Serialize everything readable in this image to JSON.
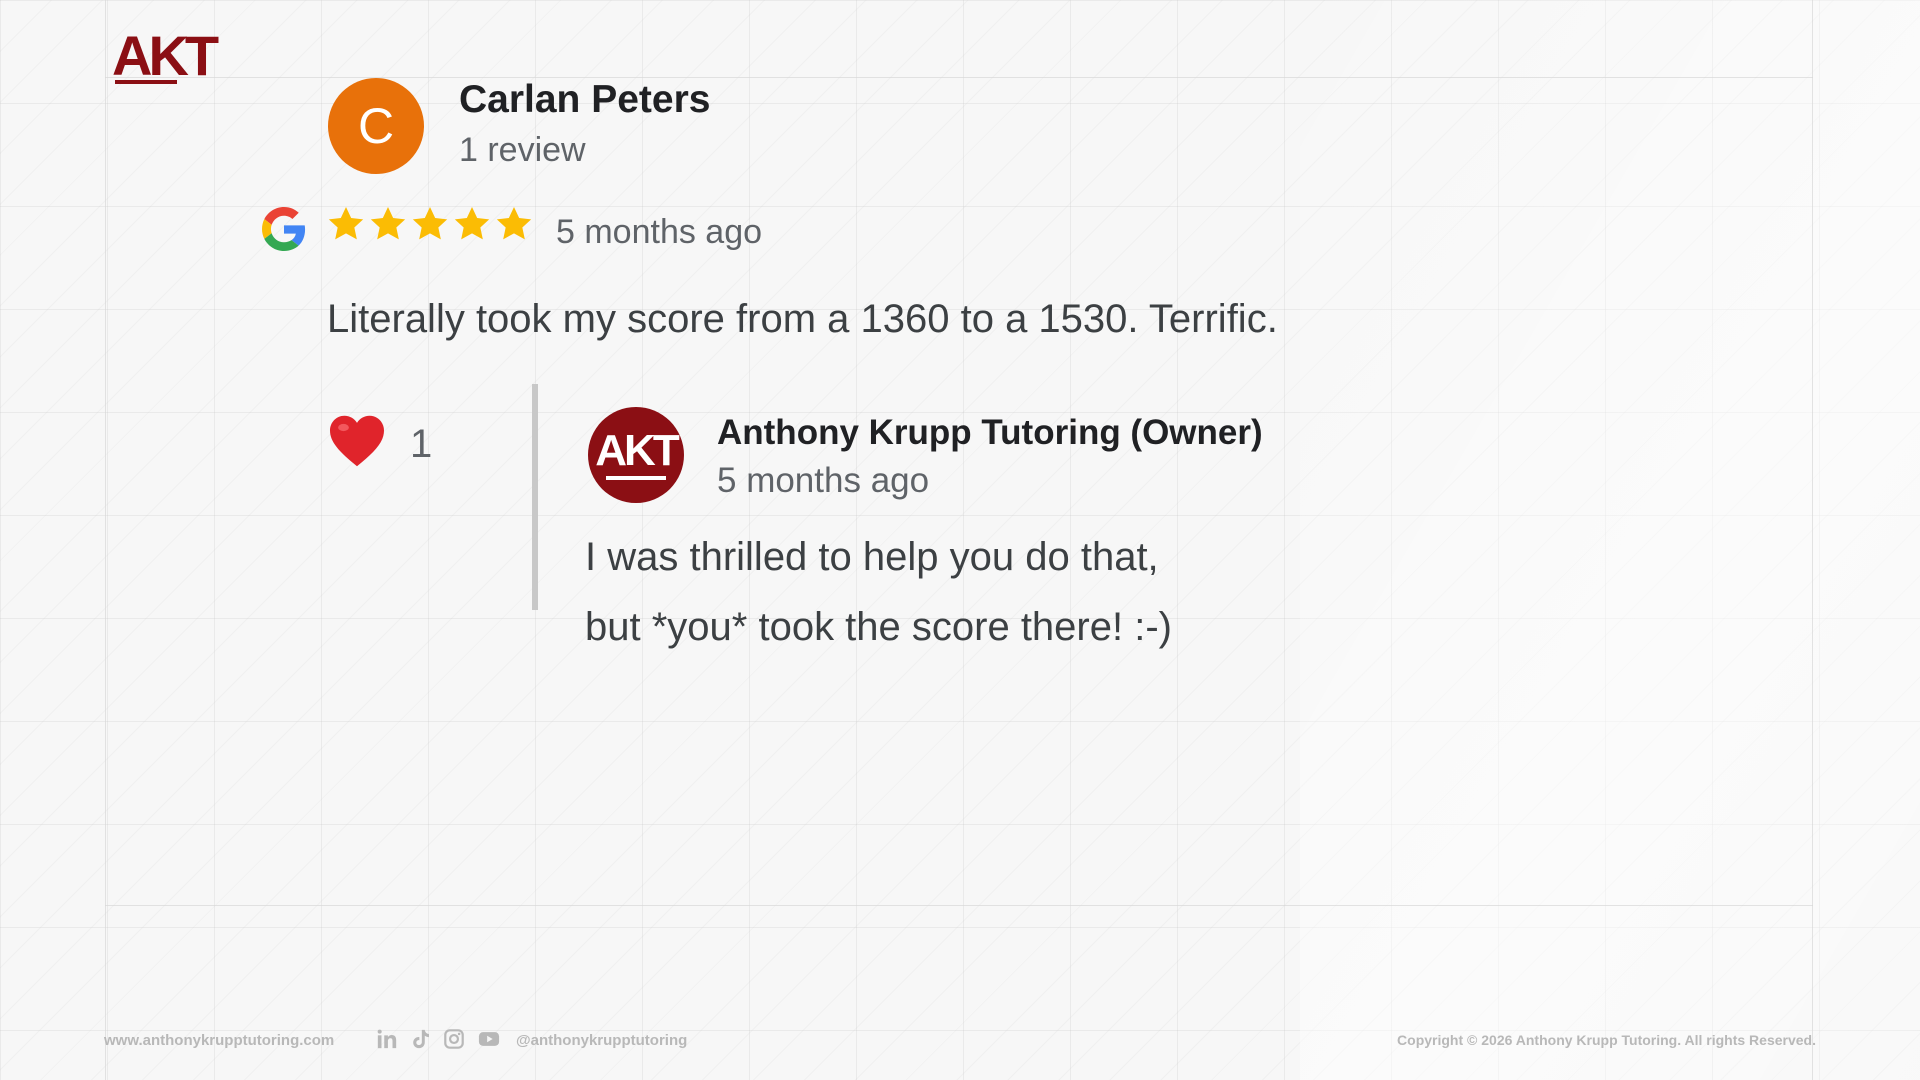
{
  "brand": {
    "logo_text": "AKT"
  },
  "review": {
    "avatar_letter": "C",
    "reviewer_name": "Carlan Peters",
    "reviewer_sub": "1 review",
    "rating": 5,
    "time": "5 months ago",
    "text": "Literally took my score from a 1360 to a 1530. Terrific.",
    "likes": "1"
  },
  "reply": {
    "avatar_text": "AKT",
    "owner_name": "Anthony Krupp Tutoring (Owner)",
    "time": "5 months ago",
    "lines": [
      "I was thrilled to help you do that,",
      "but *you* took the score there! :-)"
    ]
  },
  "footer": {
    "website": "www.anthonykrupptutoring.com",
    "handle": "@anthonykrupptutoring",
    "copyright": "Copyright © 2026 Anthony Krupp Tutoring. All rights Reserved.",
    "social_icons": [
      "linkedin-icon",
      "tiktok-icon",
      "instagram-icon",
      "youtube-icon"
    ]
  },
  "colors": {
    "brand": "#8b0f14",
    "avatar_orange": "#e8710a",
    "star": "#fbbc04",
    "heart": "#e0242b"
  }
}
